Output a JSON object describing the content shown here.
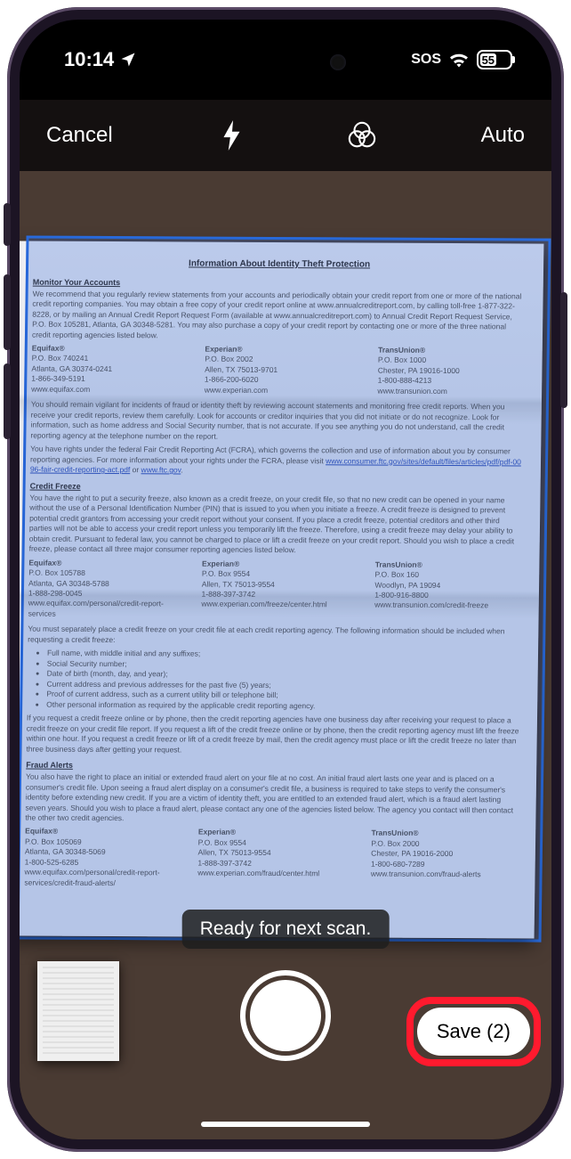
{
  "status_bar": {
    "time": "10:14",
    "location_icon": "location-arrow",
    "sos": "SOS",
    "wifi_icon": "wifi",
    "battery_pct": "55"
  },
  "toolbar": {
    "cancel": "Cancel",
    "flash_icon": "flash",
    "filter_icon": "color-filter",
    "auto": "Auto"
  },
  "scan_status": "Ready for next scan.",
  "save_button": "Save (2)",
  "document": {
    "title": "Information About Identity Theft Protection",
    "sec_monitor": "Monitor Your Accounts",
    "p_monitor": "We recommend that you regularly review statements from your accounts and periodically obtain your credit report from one or more of the national credit reporting companies. You may obtain a free copy of your credit report online at www.annualcreditreport.com, by calling toll-free 1-877-322-8228, or by mailing an Annual Credit Report Request Form (available at www.annualcreditreport.com) to Annual Credit Report Request Service, P.O. Box 105281, Atlanta, GA 30348-5281. You may also purchase a copy of your credit report by contacting one or more of the three national credit reporting agencies listed below.",
    "agencies1": [
      {
        "name": "Equifax®",
        "addr1": "P.O. Box 740241",
        "addr2": "Atlanta, GA 30374-0241",
        "ph": "1-866-349-5191",
        "url": "www.equifax.com"
      },
      {
        "name": "Experian®",
        "addr1": "P.O. Box 2002",
        "addr2": "Allen, TX 75013-9701",
        "ph": "1-866-200-6020",
        "url": "www.experian.com"
      },
      {
        "name": "TransUnion®",
        "addr1": "P.O. Box 1000",
        "addr2": "Chester, PA 19016-1000",
        "ph": "1-800-888-4213",
        "url": "www.transunion.com"
      }
    ],
    "p_vigilant": "You should remain vigilant for incidents of fraud or identity theft by reviewing account statements and monitoring free credit reports. When you receive your credit reports, review them carefully. Look for accounts or creditor inquiries that you did not initiate or do not recognize. Look for information, such as home address and Social Security number, that is not accurate. If you see anything you do not understand, call the credit reporting agency at the telephone number on the report.",
    "p_fcra1": "You have rights under the federal Fair Credit Reporting Act (FCRA), which governs the collection and use of information about you by consumer reporting agencies. For more information about your rights under the FCRA, please visit",
    "fcra_link": "www.consumer.ftc.gov/sites/default/files/articles/pdf/pdf-0096-fair-credit-reporting-act.pdf",
    "fcra_or": " or ",
    "fcra_link2": "www.ftc.gov",
    "sec_freeze": "Credit Freeze",
    "p_freeze": "You have the right to put a security freeze, also known as a credit freeze, on your credit file, so that no new credit can be opened in your name without the use of a Personal Identification Number (PIN) that is issued to you when you initiate a freeze. A credit freeze is designed to prevent potential credit grantors from accessing your credit report without your consent. If you place a credit freeze, potential creditors and other third parties will not be able to access your credit report unless you temporarily lift the freeze. Therefore, using a credit freeze may delay your ability to obtain credit. Pursuant to federal law, you cannot be charged to place or lift a credit freeze on your credit report. Should you wish to place a credit freeze, please contact all three major consumer reporting agencies listed below.",
    "agencies2": [
      {
        "name": "Equifax®",
        "addr1": "P.O. Box 105788",
        "addr2": "Atlanta, GA 30348-5788",
        "ph": "1-888-298-0045",
        "url": "www.equifax.com/personal/credit-report-services"
      },
      {
        "name": "Experian®",
        "addr1": "P.O. Box 9554",
        "addr2": "Allen, TX 75013-9554",
        "ph": "1-888-397-3742",
        "url": "www.experian.com/freeze/center.html"
      },
      {
        "name": "TransUnion®",
        "addr1": "P.O. Box 160",
        "addr2": "Woodlyn, PA 19094",
        "ph": "1-800-916-8800",
        "url": "www.transunion.com/credit-freeze"
      }
    ],
    "p_separate": "You must separately place a credit freeze on your credit file at each credit reporting agency. The following information should be included when requesting a credit freeze:",
    "list": [
      "Full name, with middle initial and any suffixes;",
      "Social Security number;",
      "Date of birth (month, day, and year);",
      "Current address and previous addresses for the past five (5) years;",
      "Proof of current address, such as a current utility bill or telephone bill;",
      "Other personal information as required by the applicable credit reporting agency."
    ],
    "p_request": "If you request a credit freeze online or by phone, then the credit reporting agencies have one business day after receiving your request to place a credit freeze on your credit file report. If you request a lift of the credit freeze online or by phone, then the credit reporting agency must lift the freeze within one hour. If you request a credit freeze or lift of a credit freeze by mail, then the credit agency must place or lift the credit freeze no later than three business days after getting your request.",
    "sec_fraud": "Fraud Alerts",
    "p_fraud": "You also have the right to place an initial or extended fraud alert on your file at no cost. An initial fraud alert lasts one year and is placed on a consumer's credit file. Upon seeing a fraud alert display on a consumer's credit file, a business is required to take steps to verify the consumer's identity before extending new credit. If you are a victim of identity theft, you are entitled to an extended fraud alert, which is a fraud alert lasting seven years. Should you wish to place a fraud alert, please contact any one of the agencies listed below. The agency you contact will then contact the other two credit agencies.",
    "agencies3": [
      {
        "name": "Equifax®",
        "addr1": "P.O. Box 105069",
        "addr2": "Atlanta, GA 30348-5069",
        "ph": "1-800-525-6285",
        "url": "www.equifax.com/personal/credit-report-services/credit-fraud-alerts/"
      },
      {
        "name": "Experian®",
        "addr1": "P.O. Box 9554",
        "addr2": "Allen, TX 75013-9554",
        "ph": "1-888-397-3742",
        "url": "www.experian.com/fraud/center.html"
      },
      {
        "name": "TransUnion®",
        "addr1": "P.O. Box 2000",
        "addr2": "Chester, PA 19016-2000",
        "ph": "1-800-680-7289",
        "url": "www.transunion.com/fraud-alerts"
      }
    ]
  }
}
